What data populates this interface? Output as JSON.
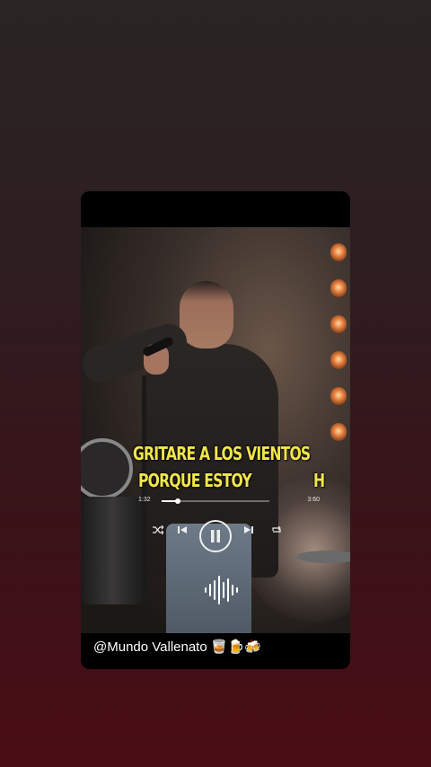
{
  "lyrics": {
    "line1": "GRITARE A LOS VIENTOS",
    "line2": "PORQUE ESTOY",
    "trailing_letter": "H"
  },
  "player": {
    "current_time": "1:32",
    "total_time": "3:60",
    "progress": 0.15,
    "state": "playing"
  },
  "caption": {
    "text": "@Mundo Vallenato",
    "emojis": "🥃🍺🍻"
  },
  "icons": {
    "shuffle": "shuffle-icon",
    "previous": "previous-icon",
    "pause": "pause-icon",
    "next": "next-icon",
    "repeat": "repeat-icon",
    "audio_wave": "audio-wave-icon"
  },
  "colors": {
    "lyric": "#f2e64a",
    "background_top": "#2a2425",
    "background_bottom": "#4a0c14"
  }
}
